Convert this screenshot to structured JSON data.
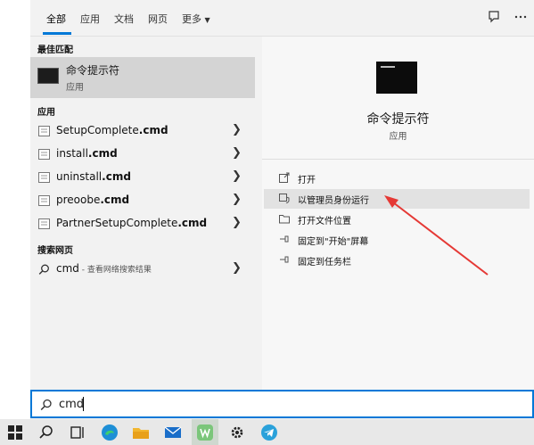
{
  "tabs": {
    "all": "全部",
    "apps": "应用",
    "docs": "文档",
    "web": "网页",
    "more": "更多"
  },
  "best_match": {
    "section_label": "最佳匹配",
    "title": "命令提示符",
    "subtitle": "应用"
  },
  "apps_section": {
    "label": "应用",
    "items": [
      {
        "name": "SetupComplete",
        "ext": ".cmd"
      },
      {
        "name": "install",
        "ext": ".cmd"
      },
      {
        "name": "uninstall",
        "ext": ".cmd"
      },
      {
        "name": "preoobe",
        "ext": ".cmd"
      },
      {
        "name": "PartnerSetupComplete",
        "ext": ".cmd"
      }
    ]
  },
  "web_section": {
    "label": "搜索网页",
    "query": "cmd",
    "suffix": " - 查看网络搜索结果"
  },
  "detail": {
    "title": "命令提示符",
    "subtitle": "应用"
  },
  "actions": {
    "open": "打开",
    "run_as_admin": "以管理员身份运行",
    "open_file_location": "打开文件位置",
    "pin_start": "固定到\"开始\"屏幕",
    "pin_taskbar": "固定到任务栏"
  },
  "search": {
    "value": "cmd"
  },
  "colors": {
    "accent": "#0078d7",
    "annotation_arrow": "#e53935"
  }
}
